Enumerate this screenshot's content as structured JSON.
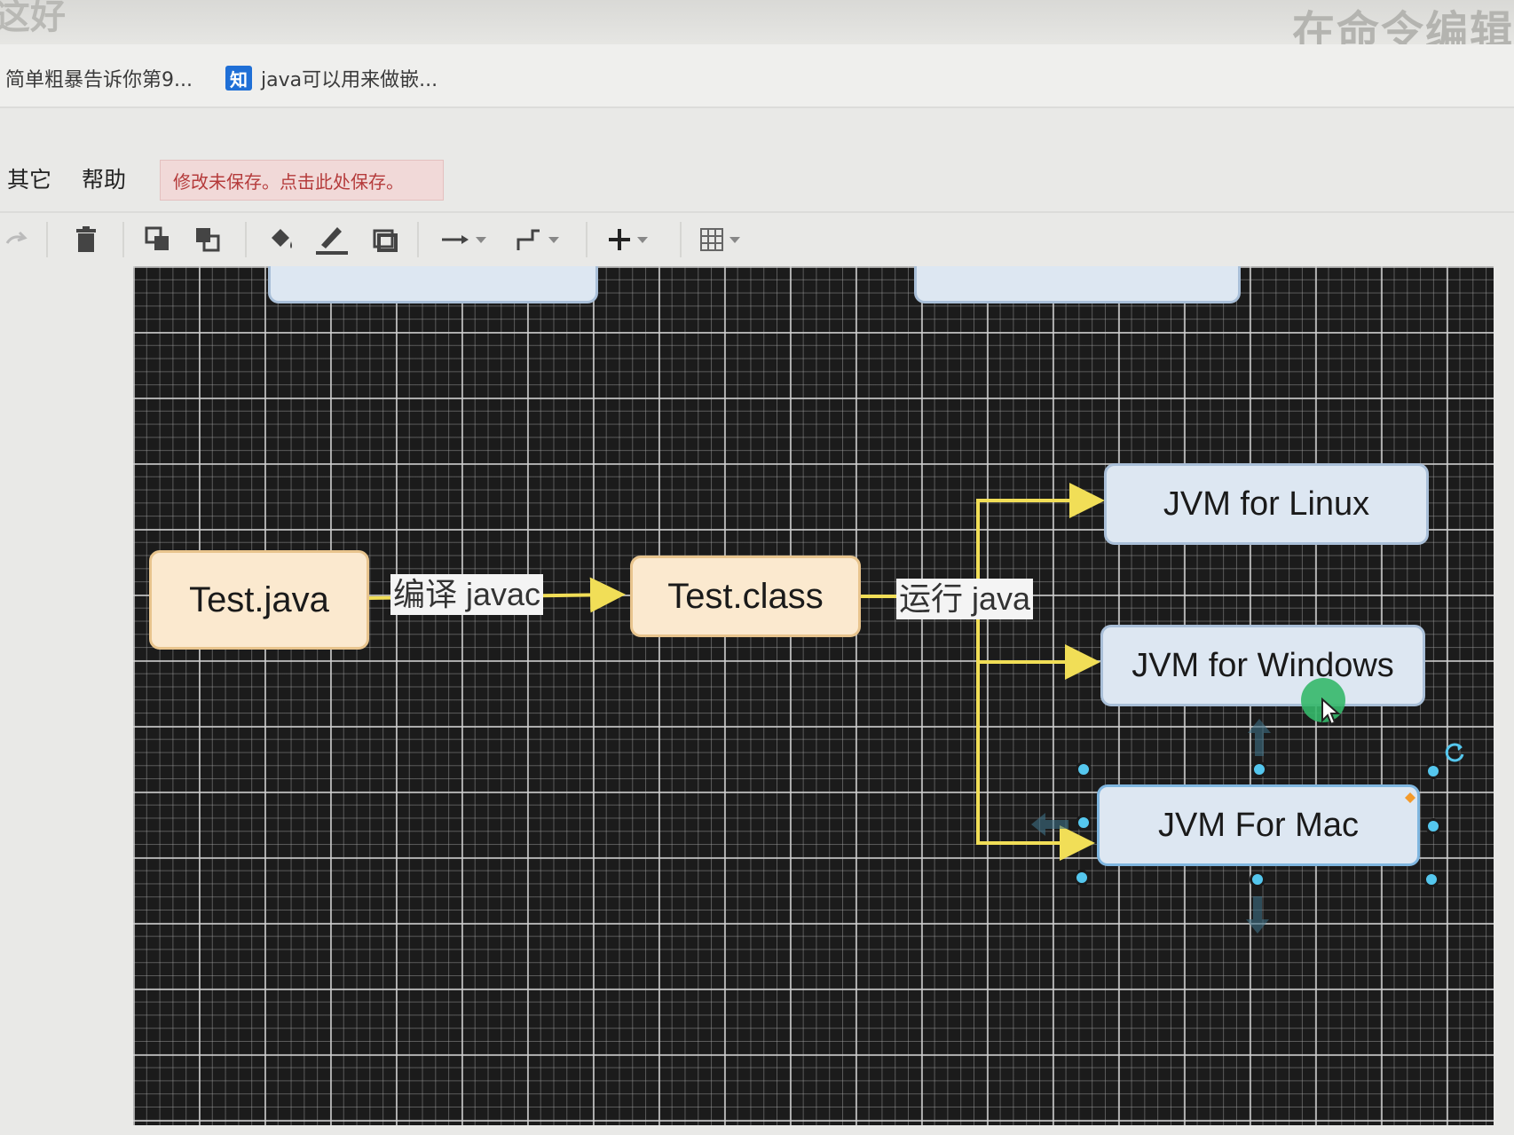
{
  "window": {
    "title_fragment": "这好",
    "right_title": "在命令编辑"
  },
  "tabs": [
    {
      "label": "简单粗暴告诉你第9..."
    },
    {
      "icon_text": "知",
      "label": "java可以用来做嵌..."
    }
  ],
  "menu": {
    "items": [
      "其它",
      "帮助"
    ],
    "save_notice": "修改未保存。点击此处保存。"
  },
  "toolbar": {
    "icons": [
      "redo-icon",
      "delete-icon",
      "bring-front-icon",
      "send-back-icon",
      "fill-color-icon",
      "line-color-icon",
      "shadow-icon",
      "connector-style-icon",
      "waypoint-style-icon",
      "insert-plus-icon",
      "table-icon"
    ]
  },
  "colors": {
    "canvas_bg": "#1b1b1b",
    "arrow": "#f1de57",
    "source_node_fill": "#fbe9cf",
    "target_node_fill": "#dde7f2",
    "handle": "#55c7ee"
  },
  "diagram": {
    "nodes": {
      "test_java": "Test.java",
      "test_class": "Test.class",
      "jvm_linux": "JVM for Linux",
      "jvm_windows": "JVM for Windows",
      "jvm_mac": "JVM For Mac"
    },
    "edges": {
      "compile": "编译 javac",
      "run": "运行 java"
    }
  }
}
